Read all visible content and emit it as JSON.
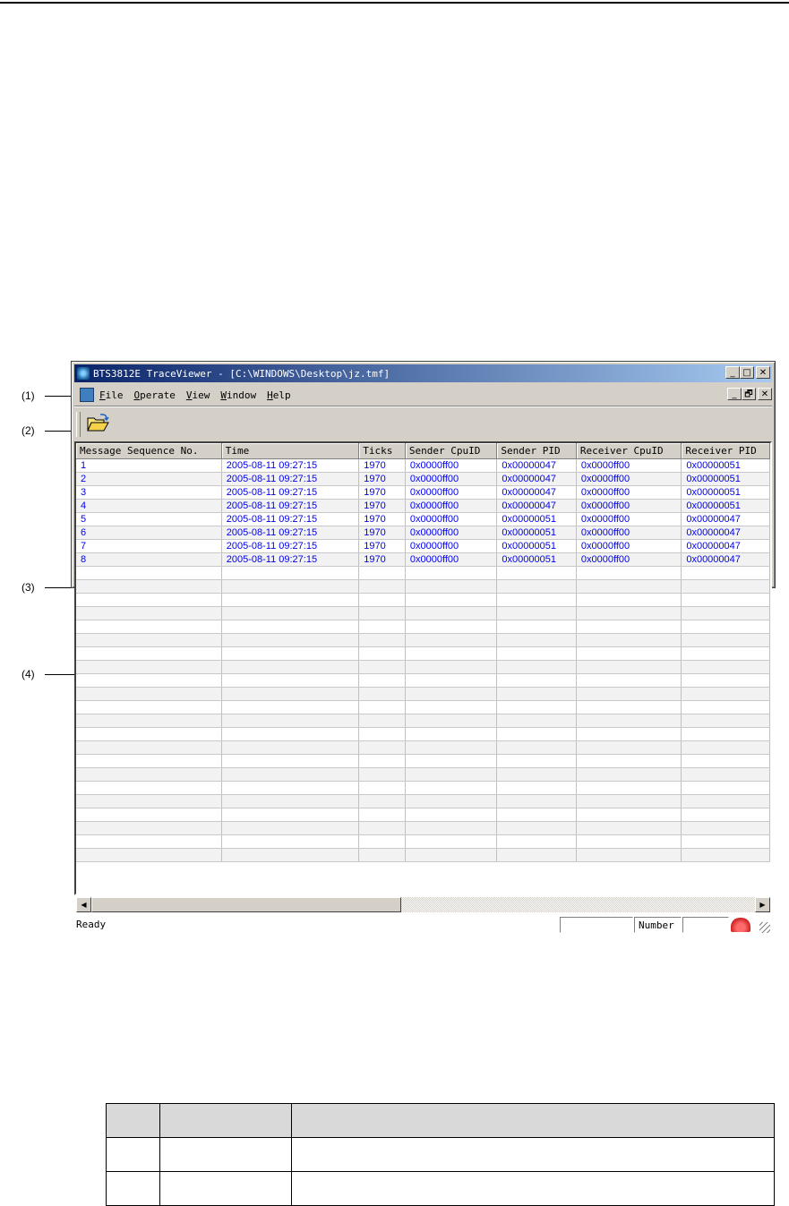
{
  "window": {
    "title": "BTS3812E TraceViewer - [C:\\WINDOWS\\Desktop\\jz.tmf]",
    "controls": {
      "minimize": "_",
      "maximize": "□",
      "close": "✕",
      "restore": "🗗"
    }
  },
  "callouts": [
    "(1)",
    "(2)",
    "(3)",
    "(4)"
  ],
  "menu": {
    "items": [
      {
        "accel": "F",
        "rest": "ile"
      },
      {
        "accel": "O",
        "rest": "perate"
      },
      {
        "accel": "V",
        "rest": "iew"
      },
      {
        "accel": "W",
        "rest": "indow"
      },
      {
        "accel": "H",
        "rest": "elp"
      }
    ]
  },
  "toolbar": {
    "open_icon": "folder-open-icon"
  },
  "grid": {
    "columns": [
      "Message Sequence No.",
      "Time",
      "Ticks",
      "Sender CpuID",
      "Sender PID",
      "Receiver CpuID",
      "Receiver PID"
    ],
    "rows": [
      [
        "1",
        "2005-08-11 09:27:15",
        "1970",
        "0x0000ff00",
        "0x00000047",
        "0x0000ff00",
        "0x00000051"
      ],
      [
        "2",
        "2005-08-11 09:27:15",
        "1970",
        "0x0000ff00",
        "0x00000047",
        "0x0000ff00",
        "0x00000051"
      ],
      [
        "3",
        "2005-08-11 09:27:15",
        "1970",
        "0x0000ff00",
        "0x00000047",
        "0x0000ff00",
        "0x00000051"
      ],
      [
        "4",
        "2005-08-11 09:27:15",
        "1970",
        "0x0000ff00",
        "0x00000047",
        "0x0000ff00",
        "0x00000051"
      ],
      [
        "5",
        "2005-08-11 09:27:15",
        "1970",
        "0x0000ff00",
        "0x00000051",
        "0x0000ff00",
        "0x00000047"
      ],
      [
        "6",
        "2005-08-11 09:27:15",
        "1970",
        "0x0000ff00",
        "0x00000051",
        "0x0000ff00",
        "0x00000047"
      ],
      [
        "7",
        "2005-08-11 09:27:15",
        "1970",
        "0x0000ff00",
        "0x00000051",
        "0x0000ff00",
        "0x00000047"
      ],
      [
        "8",
        "2005-08-11 09:27:15",
        "1970",
        "0x0000ff00",
        "0x00000051",
        "0x0000ff00",
        "0x00000047"
      ]
    ],
    "empty_rows": 22
  },
  "scrollbar": {
    "left_arrow": "◀",
    "right_arrow": "▶"
  },
  "status": {
    "text": "Ready",
    "pane_label": "Number"
  },
  "colors": {
    "title_start": "#0a246a",
    "title_end": "#a6caf0",
    "cell_text": "#0000ee",
    "face": "#d4d0c8"
  }
}
